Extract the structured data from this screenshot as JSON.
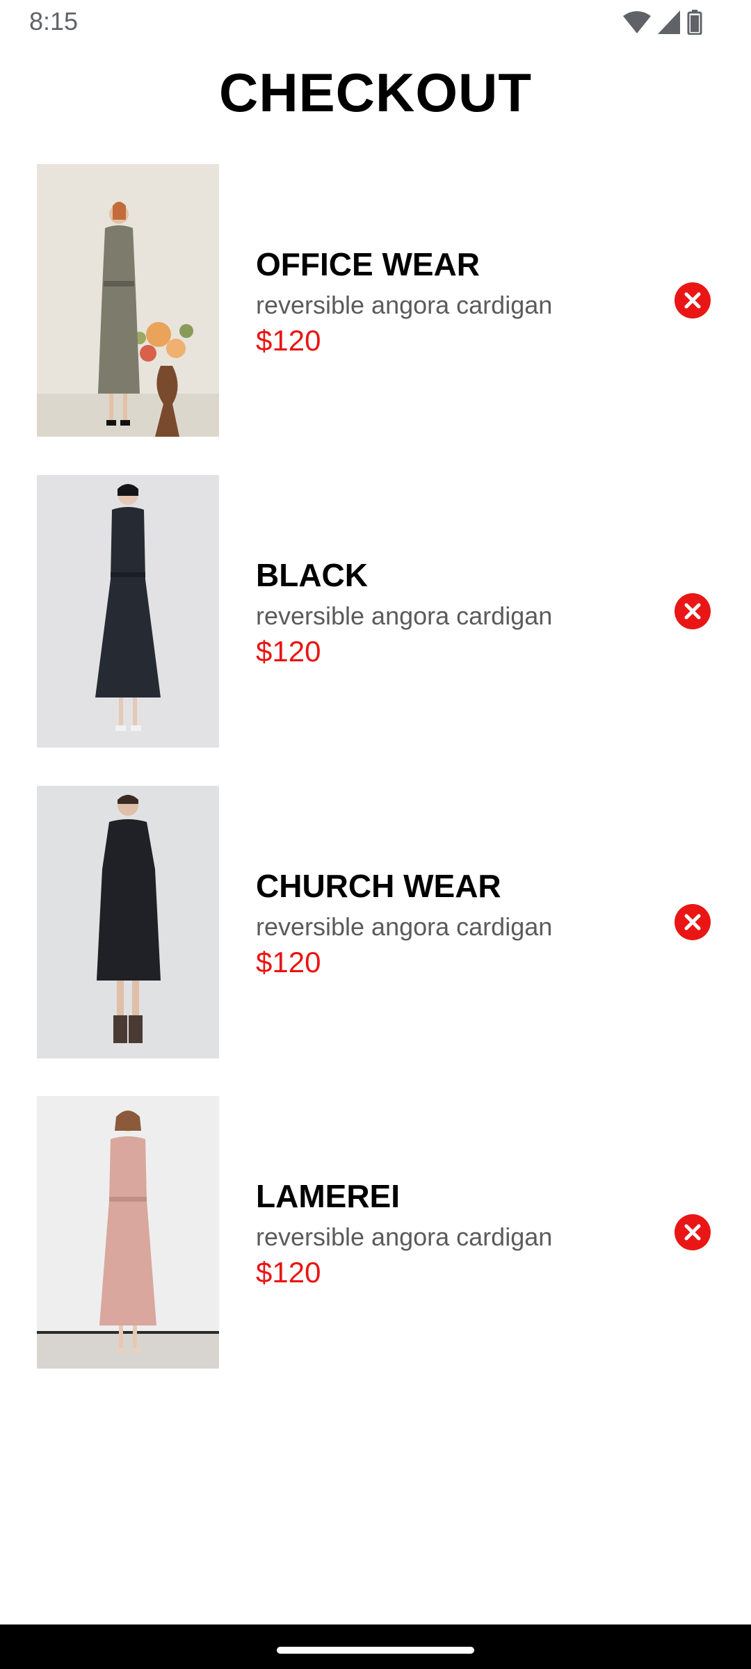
{
  "status_bar": {
    "time": "8:15",
    "icons": [
      "wifi-icon",
      "cell-signal-icon",
      "battery-icon"
    ]
  },
  "page": {
    "title": "CHECKOUT"
  },
  "cart": {
    "items": [
      {
        "name": "OFFICE WEAR",
        "description": "reversible angora cardigan",
        "price": "$120",
        "image": "olive-dress-photo",
        "remove_icon": "close-circle-icon"
      },
      {
        "name": "BLACK",
        "description": "reversible angora cardigan",
        "price": "$120",
        "image": "navy-dress-photo",
        "remove_icon": "close-circle-icon"
      },
      {
        "name": "CHURCH WEAR",
        "description": "reversible angora cardigan",
        "price": "$120",
        "image": "black-dress-photo",
        "remove_icon": "close-circle-icon"
      },
      {
        "name": "LAMEREI",
        "description": "reversible angora cardigan",
        "price": "$120",
        "image": "pink-dress-photo",
        "remove_icon": "close-circle-icon"
      }
    ]
  },
  "colors": {
    "price": "#ea1414",
    "remove_button": "#ea1616",
    "nav_bar": "#000000"
  }
}
